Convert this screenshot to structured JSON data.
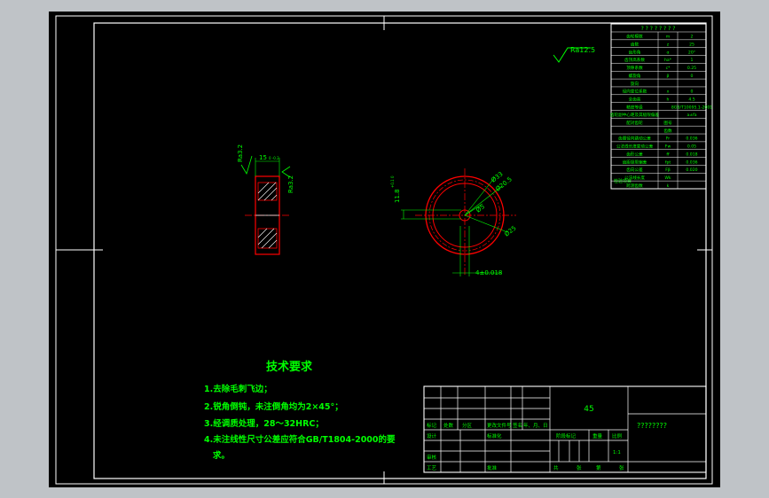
{
  "drawing": {
    "roughness_general": "Ra12.5",
    "side_view": {
      "ra_left": "Ra3.2",
      "ra_right": "Ra3.2",
      "width_dim": "15",
      "width_tol": "0 -0.2"
    },
    "front_view": {
      "dia_outer": "Ø33",
      "dia_root": "Ø20.5",
      "dia_pitch": "Ø25",
      "dia_bore": "Ø5",
      "keyway_height": "11.8",
      "keyway_tol": "+0.1 0",
      "keyway_width": "4±0.018"
    }
  },
  "param_table": {
    "header": "? ? ? ? ? ? ? ?",
    "rows": [
      {
        "name": "齿轮模数",
        "sym": "m",
        "val": "2"
      },
      {
        "name": "齿数",
        "sym": "z",
        "val": "25"
      },
      {
        "name": "齿形角",
        "sym": "α",
        "val": "20°"
      },
      {
        "name": "齿顶高系数",
        "sym": "ha*",
        "val": "1"
      },
      {
        "name": "顶隙系数",
        "sym": "c*",
        "val": "0.25"
      },
      {
        "name": "螺旋角",
        "sym": "β",
        "val": "0"
      },
      {
        "name": "旋向",
        "sym": "",
        "val": ""
      },
      {
        "name": "径向变位系数",
        "sym": "x",
        "val": "0"
      },
      {
        "name": "全齿高",
        "sym": "h",
        "val": "4.5"
      },
      {
        "name": "精度等级",
        "sym": "",
        "val": "8GB/T10095.1-2001"
      },
      {
        "name": "齿轮副中心距及其极限偏差",
        "sym": "",
        "val": "a±fa"
      },
      {
        "name": "配对齿轮",
        "sym": "图号",
        "val": ""
      },
      {
        "name": "",
        "sym": "齿数",
        "val": ""
      },
      {
        "name": "齿圈径向跳动公差",
        "sym": "Fr",
        "val": "0.036"
      },
      {
        "name": "公法线长度变动公差",
        "sym": "Fw",
        "val": "0.05"
      },
      {
        "name": "齿形公差",
        "sym": "ff",
        "val": "0.018"
      },
      {
        "name": "齿距极限偏差",
        "sym": "fpt",
        "val": "0.036"
      },
      {
        "name": "齿向公差",
        "sym": "Fβ",
        "val": "0.020"
      },
      {
        "name": "公法线长度",
        "sym": "Wk",
        "val": ""
      },
      {
        "name": "跨测齿数",
        "sym": "k",
        "val": ""
      }
    ],
    "group_label": "检验项目"
  },
  "tech": {
    "title": "技术要求",
    "items": [
      "1.去除毛刺飞边；",
      "2.锐角倒钝，未注倒角均为2×45°；",
      "3.经调质处理，28～32HRC；",
      "4.未注线性尺寸公差应符合GB/T1804-2000的要",
      "   求。"
    ]
  },
  "title_block": {
    "material": "45",
    "drawing_name": "????????",
    "labels": {
      "mark": "标记",
      "count": "处数",
      "zone": "分区",
      "change_doc": "更改文件号",
      "sign": "签名",
      "date": "年、月、日",
      "design": "设计",
      "standardize": "标准化",
      "review": "审核",
      "process": "工艺",
      "approve": "批准",
      "stage_mark": "阶段标记",
      "weight": "重量",
      "scale": "比例",
      "scale_val": "1:1",
      "total": "共",
      "sheets": "张",
      "sheet_no": "第",
      "sheet_unit": "张"
    }
  },
  "colors": {
    "background": "#000000",
    "frame": "#ffffff",
    "text": "#00ff00",
    "gear_outline": "#ff0000",
    "hatch": "#ffffff",
    "center_line": "#ff0000",
    "dimension": "#00ff00"
  }
}
